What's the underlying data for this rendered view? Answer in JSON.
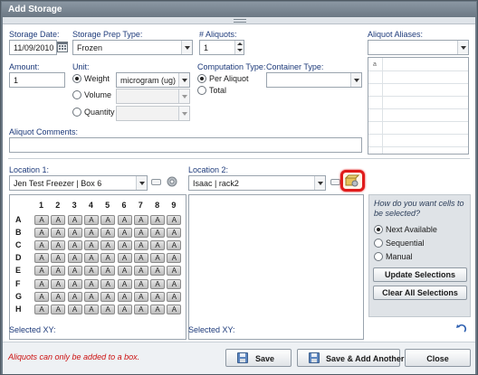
{
  "window": {
    "title": "Add Storage"
  },
  "form": {
    "storage_date": {
      "label": "Storage Date:",
      "value": "11/09/2010"
    },
    "storage_prep_type": {
      "label": "Storage Prep Type:",
      "value": "Frozen"
    },
    "num_aliquots": {
      "label": "# Aliquots:",
      "value": "1"
    },
    "aliquot_aliases": {
      "label": "Aliquot Aliases:",
      "value": "",
      "table_header": "a"
    },
    "amount": {
      "label": "Amount:",
      "value": "1"
    },
    "unit": {
      "label": "Unit:",
      "options": [
        {
          "label": "Weight",
          "selected": true,
          "value": "microgram (ug)"
        },
        {
          "label": "Volume",
          "selected": false,
          "value": ""
        },
        {
          "label": "Quantity",
          "selected": false,
          "value": ""
        }
      ]
    },
    "computation_type": {
      "label": "Computation Type:",
      "options": [
        {
          "label": "Per Aliquot",
          "selected": true
        },
        {
          "label": "Total",
          "selected": false
        }
      ]
    },
    "container_type": {
      "label": "Container Type:",
      "value": ""
    },
    "aliquot_comments": {
      "label": "Aliquot Comments:",
      "value": ""
    }
  },
  "location1": {
    "label": "Location 1:",
    "value": "Jen Test Freezer | Box 6",
    "columns": [
      "1",
      "2",
      "3",
      "4",
      "5",
      "6",
      "7",
      "8",
      "9"
    ],
    "rows": [
      "A",
      "B",
      "C",
      "D",
      "E",
      "F",
      "G",
      "H"
    ],
    "cell_label": "A",
    "selected_xy_label": "Selected XY:"
  },
  "location2": {
    "label": "Location 2:",
    "value": "Isaac | rack2",
    "selected_xy_label": "Selected XY:"
  },
  "selection_panel": {
    "question": "How do you want cells to be selected?",
    "options": [
      {
        "label": "Next Available",
        "selected": true
      },
      {
        "label": "Sequential",
        "selected": false
      },
      {
        "label": "Manual",
        "selected": false
      }
    ],
    "update_button": "Update Selections",
    "clear_button": "Clear All Selections"
  },
  "footer": {
    "warning": "Aliquots can only be added to a box.",
    "save_button": "Save",
    "save_add_button": "Save & Add Another",
    "close_button": "Close"
  },
  "colors": {
    "label_blue": "#1d3a7a",
    "warning_red": "#cc1111",
    "highlight_red": "#e01b1b",
    "title_bar": "#6b7884"
  }
}
